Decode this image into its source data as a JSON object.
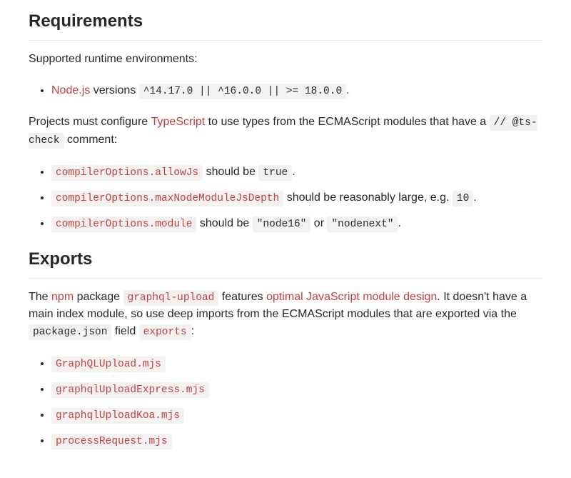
{
  "requirements": {
    "heading": "Requirements",
    "intro": "Supported runtime environments:",
    "runtime": {
      "link": "Node.js",
      "versions_pre": " versions ",
      "versions": "^14.17.0 || ^16.0.0 || >= 18.0.0",
      "versions_post": "."
    },
    "ts_intro_1": "Projects must configure ",
    "ts_link": "TypeScript",
    "ts_intro_2": " to use types from the ECMAScript modules that have a ",
    "ts_comment": "// @ts-check",
    "ts_intro_3": " comment:",
    "opts": [
      {
        "key": "compilerOptions.allowJs",
        "mid": " should be ",
        "val": "true",
        "post": "."
      },
      {
        "key": "compilerOptions.maxNodeModuleJsDepth",
        "mid": " should be reasonably large, e.g. ",
        "val": "10",
        "post": "."
      },
      {
        "key": "compilerOptions.module",
        "mid": " should be ",
        "val": "\"node16\"",
        "or": " or ",
        "val2": "\"nodenext\"",
        "post": "."
      }
    ]
  },
  "exports": {
    "heading": "Exports",
    "p1_1": "The ",
    "p1_npm": "npm",
    "p1_2": " package ",
    "p1_pkg": "graphql-upload",
    "p1_3": " features ",
    "p1_opt": "optimal JavaScript module design",
    "p1_4": ". It doesn't have a main index module, so use deep imports from the ECMAScript modules that are exported via the ",
    "p1_pkgjson": "package.json",
    "p1_5": " field ",
    "p1_exports": "exports",
    "p1_6": ":",
    "files": [
      "GraphQLUpload.mjs",
      "graphqlUploadExpress.mjs",
      "graphqlUploadKoa.mjs",
      "processRequest.mjs"
    ]
  }
}
